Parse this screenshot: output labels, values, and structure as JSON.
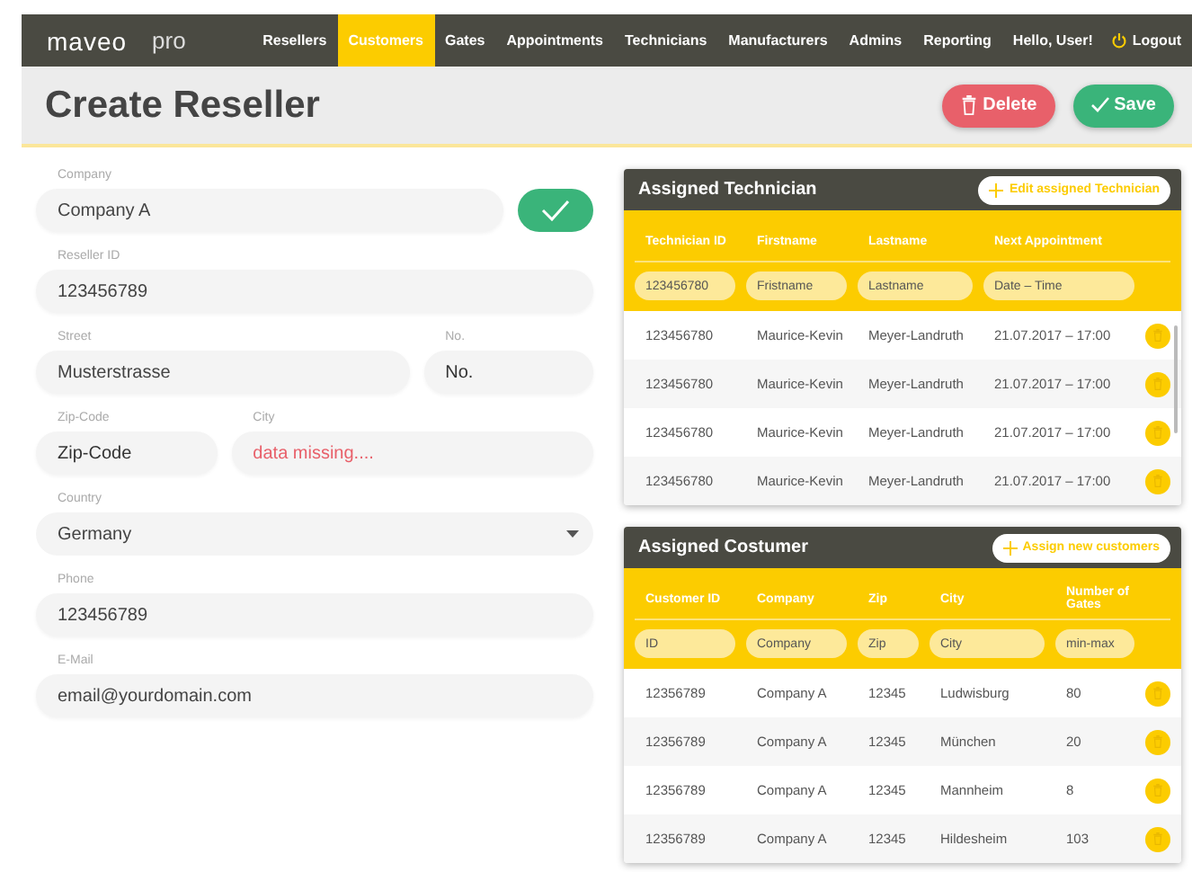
{
  "nav": {
    "logo": "maveo",
    "product": "pro",
    "items": [
      {
        "label": "Resellers",
        "selected": false
      },
      {
        "label": "Customers",
        "selected": true
      },
      {
        "label": "Gates",
        "selected": false
      },
      {
        "label": "Appointments",
        "selected": false
      },
      {
        "label": "Technicians",
        "selected": false
      },
      {
        "label": "Manufacturers",
        "selected": false
      },
      {
        "label": "Admins",
        "selected": false
      },
      {
        "label": "Reporting",
        "selected": false
      }
    ],
    "greeting": "Hello, User!",
    "logout": "Logout"
  },
  "header": {
    "title": "Create Reseller",
    "delete": "Delete",
    "save": "Save"
  },
  "form": {
    "rows": [
      [
        {
          "kind": "input",
          "label": "Company",
          "value": "Company A"
        },
        {
          "kind": "confirm"
        }
      ],
      [
        {
          "kind": "input",
          "label": "Reseller ID",
          "value": "123456789"
        }
      ],
      [
        {
          "kind": "input",
          "label": "Street",
          "value": "Musterstrasse"
        },
        {
          "kind": "input",
          "label": "No.",
          "placeholder": "No."
        }
      ],
      [
        {
          "kind": "input",
          "label": "Zip-Code",
          "placeholder": "Zip-Code"
        },
        {
          "kind": "input",
          "label": "City",
          "value": "data missing....",
          "error": true
        }
      ],
      [
        {
          "kind": "select",
          "label": "Country",
          "value": "Germany"
        }
      ],
      [
        {
          "kind": "input",
          "label": "Phone",
          "value": "123456789"
        }
      ],
      [
        {
          "kind": "input",
          "label": "E-Mail",
          "value": "email@yourdomain.com"
        }
      ]
    ]
  },
  "technicians": {
    "title": "Assigned Technician",
    "action": "Edit assigned Technician",
    "scrollable": true,
    "columns": [
      "Technician ID",
      "Firstname",
      "Lastname",
      "Next Appointment"
    ],
    "filters": [
      {
        "value": "123456780"
      },
      {
        "placeholder": "Fristname"
      },
      {
        "placeholder": "Lastname"
      },
      {
        "placeholder": "Date – Time"
      }
    ],
    "rows": [
      [
        "123456780",
        "Maurice-Kevin",
        "Meyer-Landruth",
        "21.07.2017 – 17:00"
      ],
      [
        "123456780",
        "Maurice-Kevin",
        "Meyer-Landruth",
        "21.07.2017 – 17:00"
      ],
      [
        "123456780",
        "Maurice-Kevin",
        "Meyer-Landruth",
        "21.07.2017 – 17:00"
      ],
      [
        "123456780",
        "Maurice-Kevin",
        "Meyer-Landruth",
        "21.07.2017 – 17:00"
      ]
    ]
  },
  "customers": {
    "title": "Assigned Costumer",
    "action": "Assign new customers",
    "columns": [
      "Customer ID",
      "Company",
      "Zip",
      "City",
      "Number of Gates"
    ],
    "filters": [
      {
        "placeholder": "ID"
      },
      {
        "placeholder": "Company"
      },
      {
        "placeholder": "Zip"
      },
      {
        "placeholder": "City"
      },
      {
        "placeholder": "min-max"
      }
    ],
    "rows": [
      [
        "12356789",
        "Company A",
        "12345",
        "Ludwisburg",
        "80"
      ],
      [
        "12356789",
        "Company A",
        "12345",
        "München",
        "20"
      ],
      [
        "12356789",
        "Company A",
        "12345",
        "Mannheim",
        "8"
      ],
      [
        "12356789",
        "Company A",
        "12345",
        "Hildesheim",
        "103"
      ]
    ]
  }
}
